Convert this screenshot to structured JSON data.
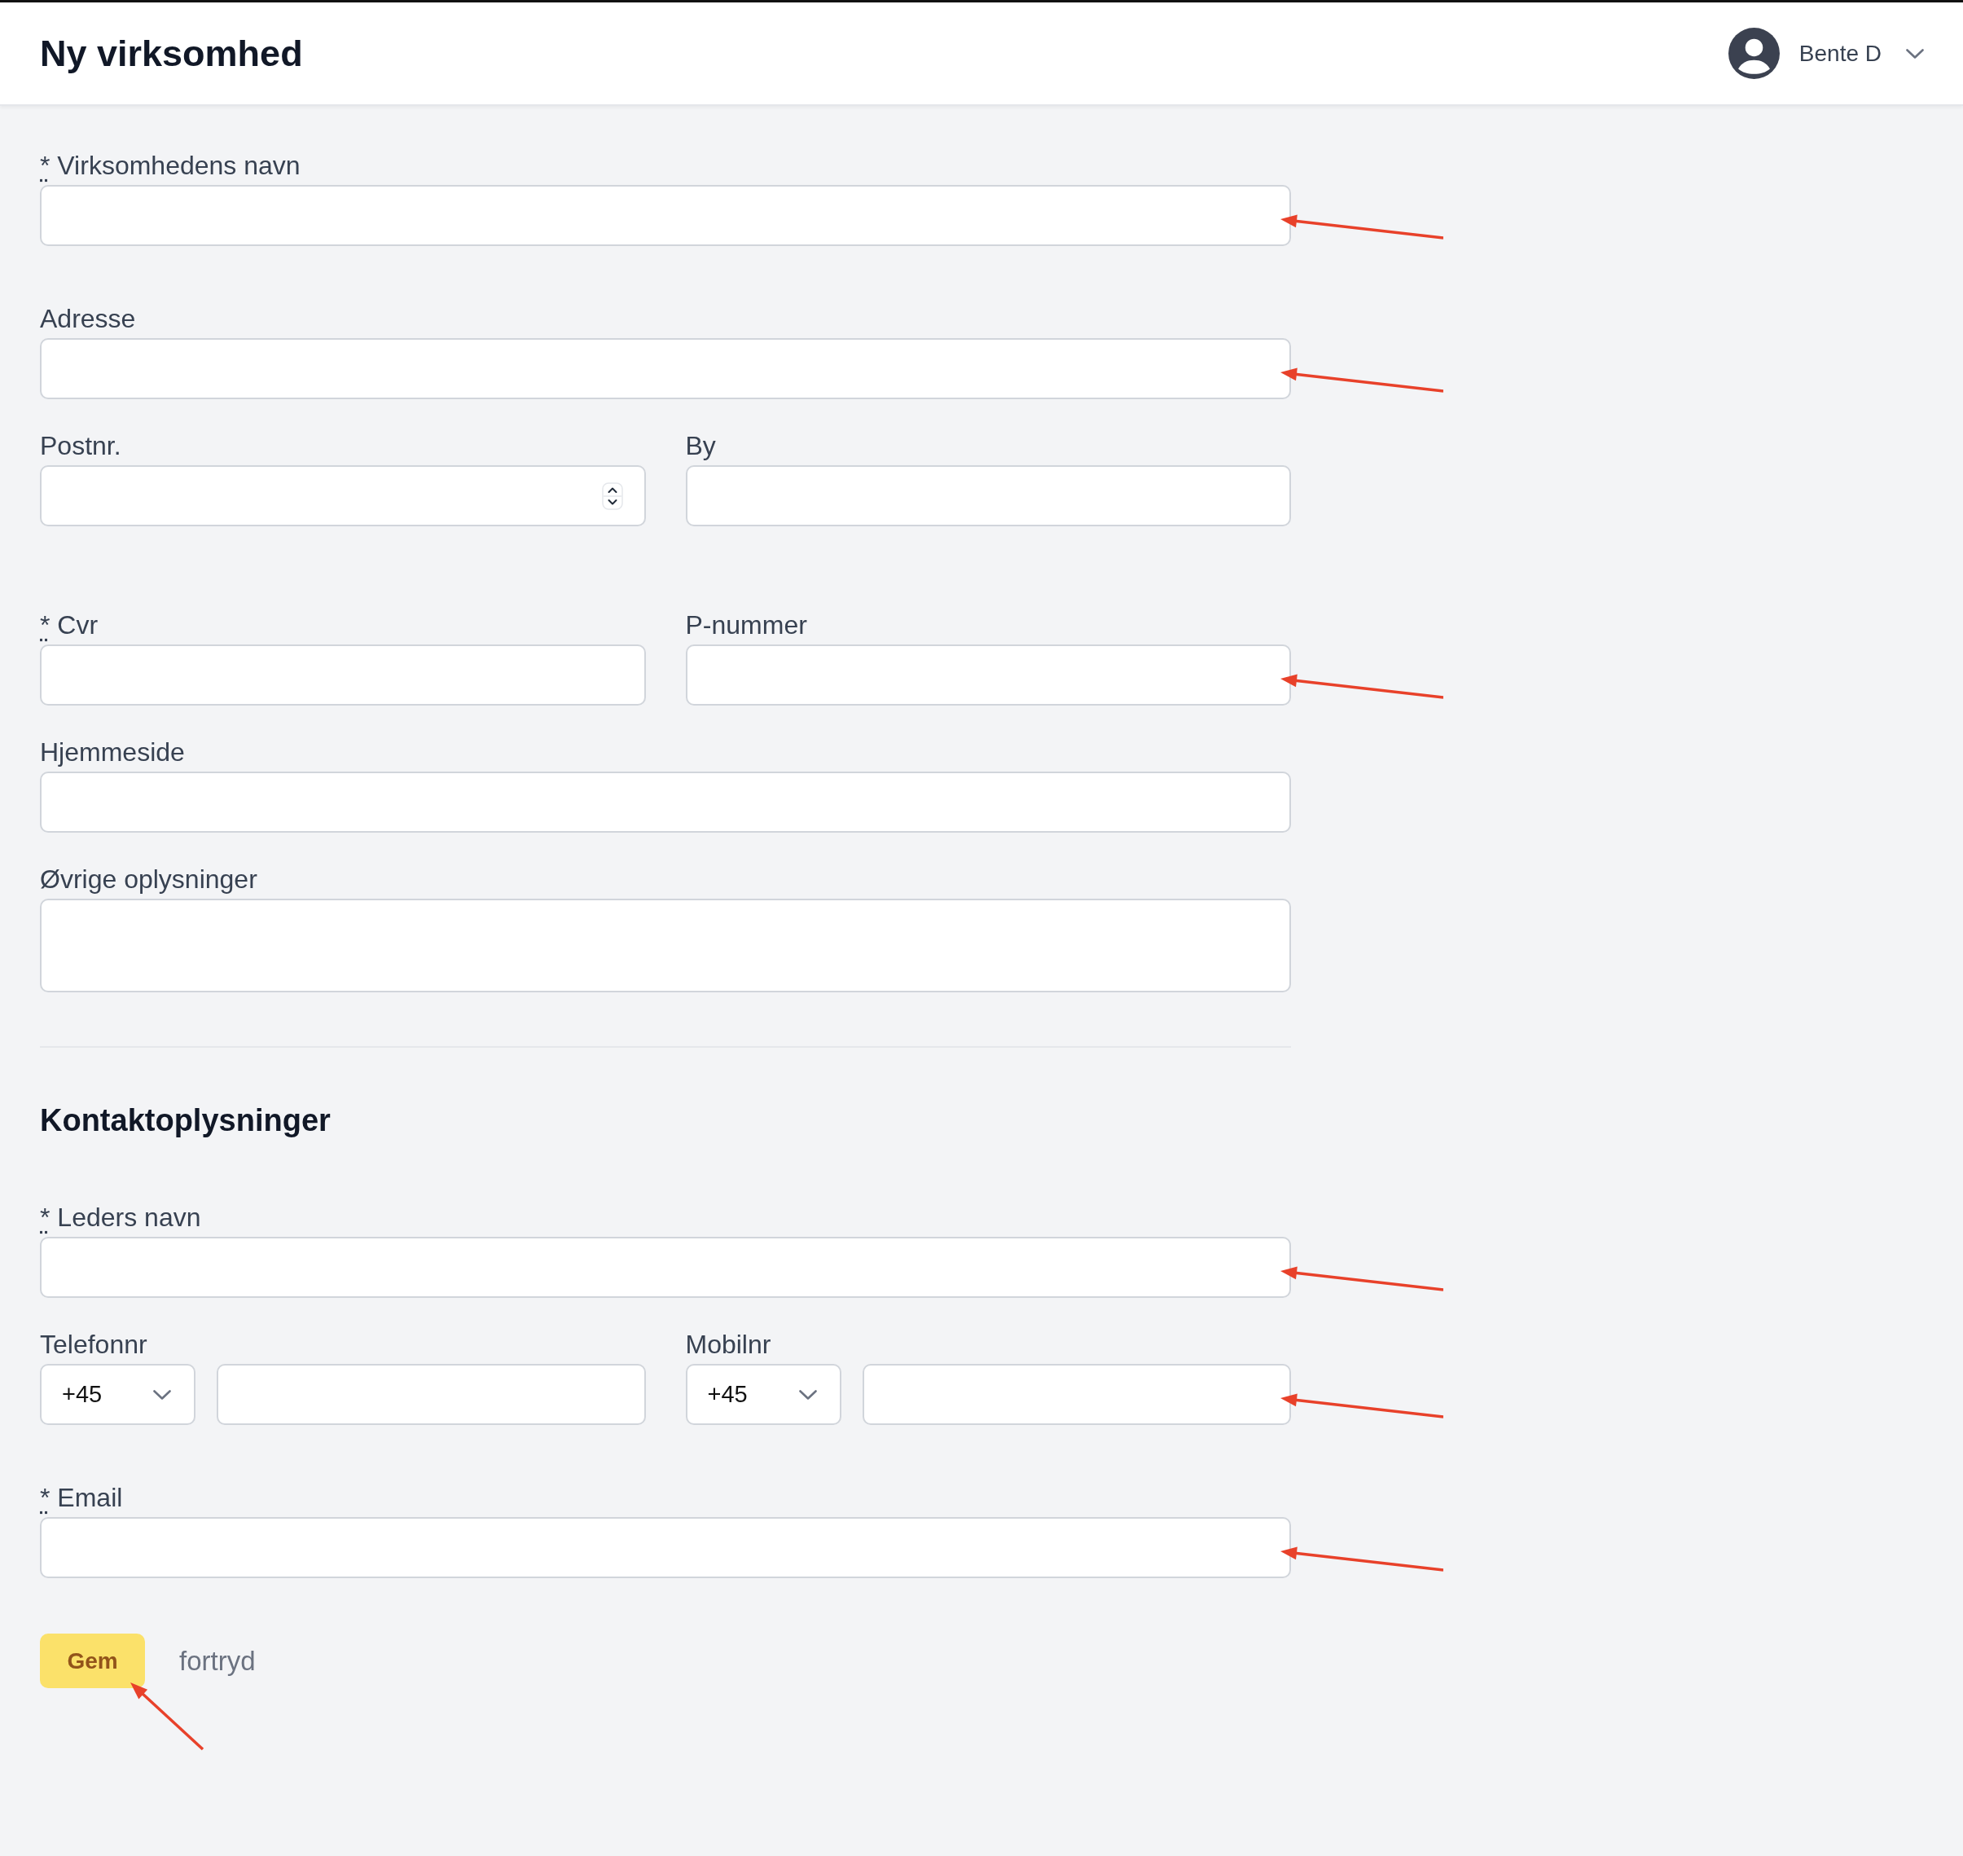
{
  "header": {
    "title": "Ny virksomhed",
    "user": {
      "name": "Bente D"
    }
  },
  "sections": [
    {
      "rows": [
        {
          "fields": [
            {
              "kind": "text",
              "required_mark": "*",
              "label": "Virksomhedens navn",
              "annotated": true
            }
          ]
        },
        {
          "fields": [
            {
              "kind": "text",
              "label": "Adresse",
              "annotated": true
            }
          ]
        },
        {
          "fields": [
            {
              "kind": "number",
              "label": "Postnr.",
              "annotated": false
            },
            {
              "kind": "text",
              "label": "By",
              "annotated": false
            }
          ]
        },
        {
          "fields": [
            {
              "kind": "text",
              "required_mark": "*",
              "label": "Cvr",
              "annotated": false
            },
            {
              "kind": "text",
              "label": "P-nummer",
              "annotated": true
            }
          ]
        },
        {
          "fields": [
            {
              "kind": "text",
              "label": "Hjemmeside",
              "annotated": false
            }
          ]
        },
        {
          "fields": [
            {
              "kind": "textarea",
              "label": "Øvrige oplysninger",
              "annotated": false
            }
          ]
        }
      ]
    },
    {
      "heading": "Kontaktoplysninger",
      "rows": [
        {
          "fields": [
            {
              "kind": "text",
              "required_mark": "*",
              "label": "Leders navn",
              "annotated": true
            }
          ]
        },
        {
          "fields": [
            {
              "kind": "phone",
              "label": "Telefonnr",
              "country_code": "+45",
              "annotated": false
            },
            {
              "kind": "phone",
              "label": "Mobilnr",
              "country_code": "+45",
              "annotated": true
            }
          ]
        },
        {
          "fields": [
            {
              "kind": "text",
              "required_mark": "*",
              "label": "Email",
              "annotated": true
            }
          ]
        }
      ]
    }
  ],
  "actions": [
    {
      "kind": "primary",
      "label": "Gem",
      "annotated": true
    },
    {
      "kind": "link",
      "label": "fortryd",
      "annotated": false
    }
  ]
}
